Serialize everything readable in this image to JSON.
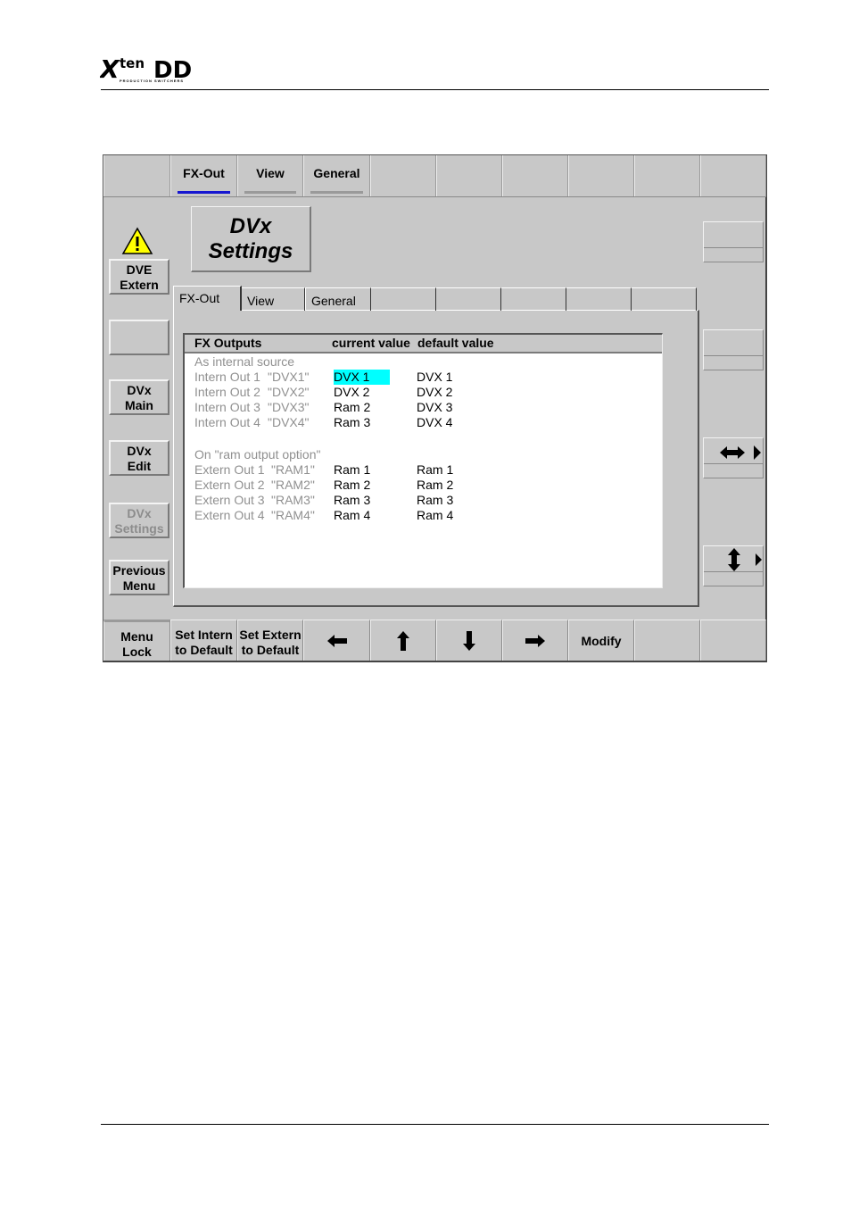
{
  "document": {
    "logo_text": "Xten DD",
    "logo_subtext": "PRODUCTION SWITCHERS"
  },
  "top_tabs": [
    {
      "label": "",
      "active": false
    },
    {
      "label": "FX-Out",
      "active": true
    },
    {
      "label": "View",
      "active": false
    },
    {
      "label": "General",
      "active": false
    },
    {
      "label": ""
    },
    {
      "label": ""
    },
    {
      "label": ""
    },
    {
      "label": ""
    },
    {
      "label": ""
    },
    {
      "label": ""
    }
  ],
  "left_menu": {
    "warning_icon": "warning-triangle-icon",
    "buttons": [
      {
        "label": "DVE\nExtern",
        "enabled": true
      },
      {
        "label": "",
        "enabled": true
      },
      {
        "label": "DVx\nMain",
        "enabled": true
      },
      {
        "label": "DVx\nEdit",
        "enabled": true
      },
      {
        "label": "DVx\nSettings",
        "enabled": false
      },
      {
        "label": "Previous\nMenu",
        "enabled": true
      }
    ]
  },
  "title_box": "DVx\nSettings",
  "sub_tabs": [
    "FX-Out",
    "View",
    "General",
    "",
    "",
    "",
    "",
    ""
  ],
  "list": {
    "headers": {
      "name": "FX Outputs",
      "current": "current value",
      "default": "default value"
    },
    "rows": [
      {
        "type": "section",
        "name": "As internal source"
      },
      {
        "name": "Intern Out 1",
        "code": "\"DVX1\"",
        "current": "DVX 1",
        "default": "DVX 1",
        "selected": true
      },
      {
        "name": "Intern Out 2",
        "code": "\"DVX2\"",
        "current": "DVX 2",
        "default": "DVX 2"
      },
      {
        "name": "Intern Out 3",
        "code": "\"DVX3\"",
        "current": "Ram 2",
        "default": "DVX 3"
      },
      {
        "name": "Intern Out 4",
        "code": "\"DVX4\"",
        "current": "Ram 3",
        "default": "DVX 4"
      },
      {
        "type": "blank"
      },
      {
        "type": "section",
        "name": "On \"ram output option\""
      },
      {
        "name": "Extern Out 1",
        "code": "\"RAM1\"",
        "current": "Ram 1",
        "default": "Ram 1"
      },
      {
        "name": "Extern Out 2",
        "code": "\"RAM2\"",
        "current": "Ram 2",
        "default": "Ram 2"
      },
      {
        "name": "Extern Out 3",
        "code": "\"RAM3\"",
        "current": "Ram 3",
        "default": "Ram 3"
      },
      {
        "name": "Extern Out 4",
        "code": "\"RAM4\"",
        "current": "Ram 4",
        "default": "Ram 4"
      }
    ],
    "selection_color": "#00ffff"
  },
  "right_controls": {
    "horizontal_icon": "left-right-arrow-icon",
    "vertical_icon": "up-down-arrow-icon"
  },
  "bottom_bar": {
    "menu_lock": "Menu\nLock",
    "set_intern": "Set Intern\nto Default",
    "set_extern": "Set Extern\nto Default",
    "left_icon": "arrow-left-icon",
    "up_icon": "arrow-up-icon",
    "down_icon": "arrow-down-icon",
    "right_icon": "arrow-right-icon",
    "modify": "Modify"
  }
}
